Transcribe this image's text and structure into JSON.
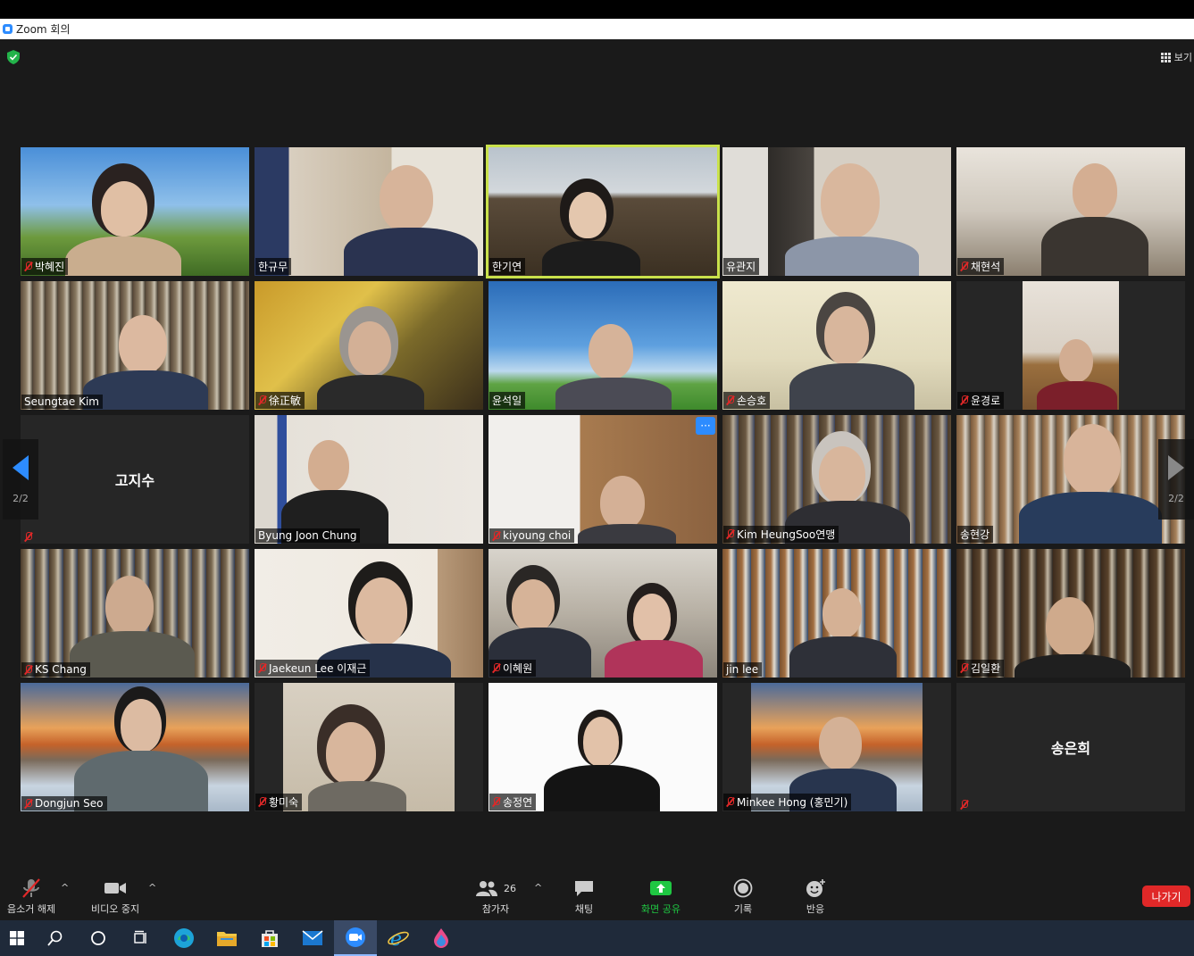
{
  "window": {
    "title": "Zoom 회의"
  },
  "header": {
    "view_label": "보기"
  },
  "tiles": [
    {
      "name": "박혜진",
      "muted": true
    },
    {
      "name": "한규무",
      "muted": false
    },
    {
      "name": "한기연",
      "muted": false
    },
    {
      "name": "유관지",
      "muted": false
    },
    {
      "name": "채현석",
      "muted": true
    },
    {
      "name": "Seungtae Kim",
      "muted": false
    },
    {
      "name": "徐正敏",
      "muted": true
    },
    {
      "name": "윤석일",
      "muted": false
    },
    {
      "name": "손승호",
      "muted": true
    },
    {
      "name": "윤경로",
      "muted": true
    },
    {
      "name": "고지수",
      "muted": true,
      "video_off": true
    },
    {
      "name": "Byung Joon Chung",
      "muted": false
    },
    {
      "name": "kiyoung choi",
      "muted": true,
      "more_badge": "···"
    },
    {
      "name": "Kim HeungSoo연맹",
      "muted": true
    },
    {
      "name": "송현강",
      "muted": false
    },
    {
      "name": "KS Chang",
      "muted": true
    },
    {
      "name": "Jaekeun Lee 이재근",
      "muted": true
    },
    {
      "name": "이혜원",
      "muted": true
    },
    {
      "name": "jin lee",
      "muted": false
    },
    {
      "name": "김일환",
      "muted": true
    },
    {
      "name": "Dongjun Seo",
      "muted": true
    },
    {
      "name": "황미숙",
      "muted": true
    },
    {
      "name": "송정연",
      "muted": true
    },
    {
      "name": "Minkee Hong (홍민기)",
      "muted": true
    },
    {
      "name": "송은희",
      "muted": true,
      "video_off": true
    }
  ],
  "pager": {
    "left": "2/2",
    "right": "2/2"
  },
  "toolbar": {
    "unmute": "음소거 해제",
    "stop_video": "비디오 중지",
    "participants": "참가자",
    "participant_count": "26",
    "chat": "채팅",
    "share": "화면 공유",
    "record": "기록",
    "reactions": "반응",
    "leave": "나가기"
  },
  "colors": {
    "accent": "#2d8cff",
    "share_green": "#1fc742",
    "leave_red": "#e02828",
    "active_speaker": "#c9e14b"
  }
}
